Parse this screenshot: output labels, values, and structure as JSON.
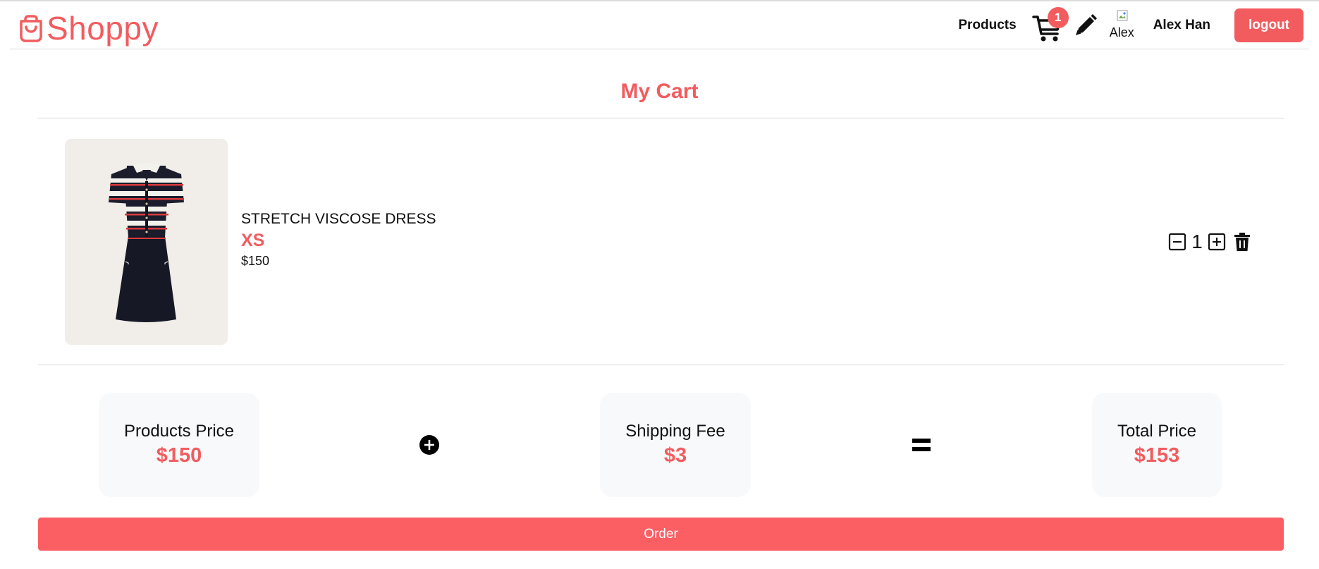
{
  "header": {
    "brand": "Shoppy",
    "nav_products": "Products",
    "cart_count": "1",
    "avatar_alt": "Alex",
    "user_name": "Alex Han",
    "logout_label": "logout"
  },
  "page": {
    "title": "My Cart"
  },
  "cart": {
    "items": [
      {
        "name": "STRETCH VISCOSE DRESS",
        "size": "XS",
        "price": "$150",
        "quantity": "1"
      }
    ]
  },
  "summary": {
    "products_label": "Products Price",
    "products_value": "$150",
    "shipping_label": "Shipping Fee",
    "shipping_value": "$3",
    "total_label": "Total Price",
    "total_value": "$153"
  },
  "order_label": "Order",
  "colors": {
    "accent": "#f25c5f",
    "card_bg": "#f8f9fb",
    "product_bg": "#f1eeea"
  },
  "icons": [
    "shopping-bag-icon",
    "cart-icon",
    "pencil-icon",
    "broken-image-icon",
    "minus-square-icon",
    "plus-square-icon",
    "trash-icon",
    "plus-circle-icon",
    "equals-icon"
  ]
}
